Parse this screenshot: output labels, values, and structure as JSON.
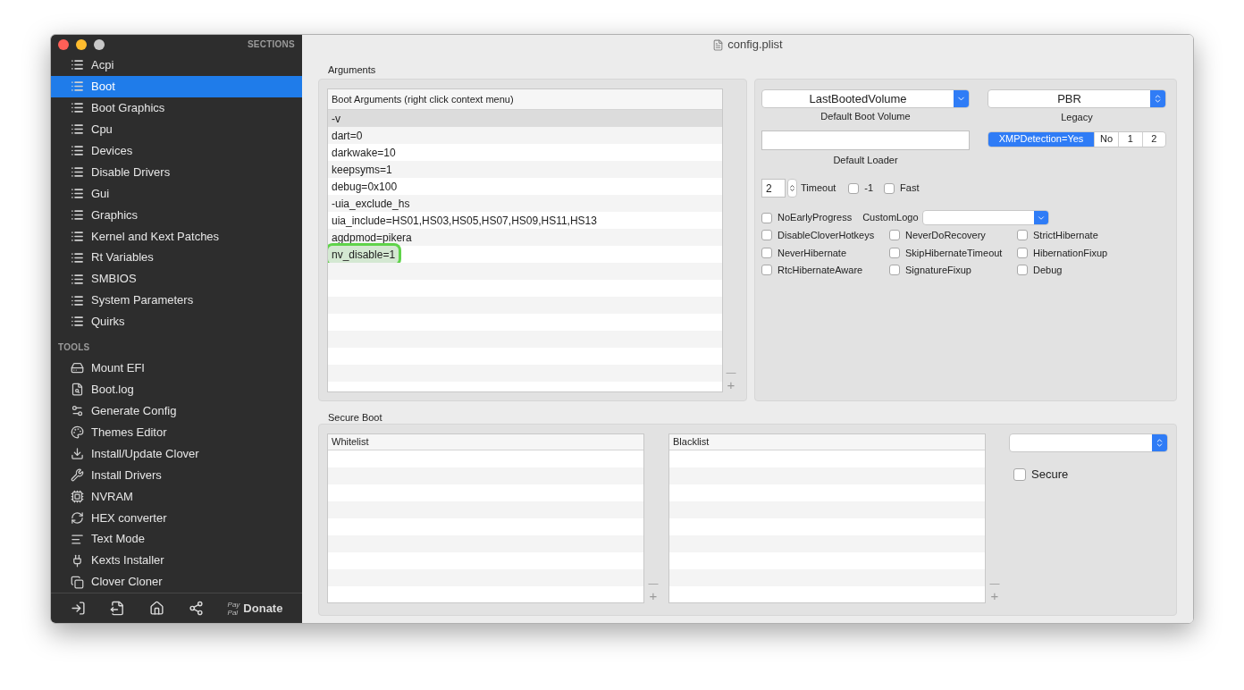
{
  "window": {
    "title": "config.plist"
  },
  "sidebar": {
    "sections_heading": "SECTIONS",
    "sections": [
      {
        "label": "Acpi",
        "selected": false
      },
      {
        "label": "Boot",
        "selected": true
      },
      {
        "label": "Boot Graphics",
        "selected": false
      },
      {
        "label": "Cpu",
        "selected": false
      },
      {
        "label": "Devices",
        "selected": false
      },
      {
        "label": "Disable Drivers",
        "selected": false
      },
      {
        "label": "Gui",
        "selected": false
      },
      {
        "label": "Graphics",
        "selected": false
      },
      {
        "label": "Kernel and Kext Patches",
        "selected": false
      },
      {
        "label": "Rt Variables",
        "selected": false
      },
      {
        "label": "SMBIOS",
        "selected": false
      },
      {
        "label": "System Parameters",
        "selected": false
      },
      {
        "label": "Quirks",
        "selected": false
      }
    ],
    "tools_heading": "TOOLS",
    "tools": [
      {
        "label": "Mount EFI"
      },
      {
        "label": "Boot.log"
      },
      {
        "label": "Generate Config"
      },
      {
        "label": "Themes Editor"
      },
      {
        "label": "Install/Update Clover"
      },
      {
        "label": "Install Drivers"
      },
      {
        "label": "NVRAM"
      },
      {
        "label": "HEX converter"
      },
      {
        "label": "Text Mode"
      },
      {
        "label": "Kexts Installer"
      },
      {
        "label": "Clover Cloner"
      }
    ],
    "donate": {
      "mark_top": "Pay",
      "mark_bottom": "Pal",
      "label": "Donate"
    }
  },
  "arguments": {
    "label": "Arguments",
    "header": "Boot Arguments (right click context menu)",
    "rows": [
      {
        "text": "-v",
        "selected": true,
        "highlighted": false
      },
      {
        "text": "dart=0",
        "selected": false,
        "highlighted": false
      },
      {
        "text": "darkwake=10",
        "selected": false,
        "highlighted": false
      },
      {
        "text": "keepsyms=1",
        "selected": false,
        "highlighted": false
      },
      {
        "text": "debug=0x100",
        "selected": false,
        "highlighted": false
      },
      {
        "text": "-uia_exclude_hs",
        "selected": false,
        "highlighted": false
      },
      {
        "text": "uia_include=HS01,HS03,HS05,HS07,HS09,HS11,HS13",
        "selected": false,
        "highlighted": false
      },
      {
        "text": "agdpmod=pikera",
        "selected": false,
        "highlighted": false
      },
      {
        "text": "nv_disable=1",
        "selected": false,
        "highlighted": true
      }
    ],
    "remove": "—",
    "add": "+"
  },
  "boot_options": {
    "default_boot_volume": {
      "value": "LastBootedVolume",
      "label": "Default Boot Volume"
    },
    "legacy": {
      "value": "PBR",
      "label": "Legacy"
    },
    "default_loader": {
      "label": "Default Loader"
    },
    "xmp": [
      {
        "label": "XMPDetection=Yes",
        "selected": true
      },
      {
        "label": "No",
        "selected": false
      },
      {
        "label": "1",
        "selected": false
      },
      {
        "label": "2",
        "selected": false
      }
    ],
    "timeout": {
      "value": "2",
      "label": "Timeout"
    },
    "timeout_checks": [
      {
        "label": "-1",
        "checked": false
      },
      {
        "label": "Fast",
        "checked": false
      }
    ],
    "no_early_progress": {
      "label": "NoEarlyProgress",
      "checked": false
    },
    "custom_logo": {
      "label": "CustomLogo"
    },
    "flags": [
      {
        "label": "DisableCloverHotkeys",
        "checked": false
      },
      {
        "label": "NeverDoRecovery",
        "checked": false
      },
      {
        "label": "StrictHibernate",
        "checked": false
      },
      {
        "label": "NeverHibernate",
        "checked": false
      },
      {
        "label": "SkipHibernateTimeout",
        "checked": false
      },
      {
        "label": "HibernationFixup",
        "checked": false
      },
      {
        "label": "RtcHibernateAware",
        "checked": false
      },
      {
        "label": "SignatureFixup",
        "checked": false
      },
      {
        "label": "Debug",
        "checked": false
      }
    ]
  },
  "secure_boot": {
    "label": "Secure Boot",
    "whitelist": {
      "header": "Whitelist",
      "remove": "—",
      "add": "+"
    },
    "blacklist": {
      "header": "Blacklist",
      "remove": "—",
      "add": "+"
    },
    "secure": {
      "label": "Secure",
      "checked": false
    }
  }
}
